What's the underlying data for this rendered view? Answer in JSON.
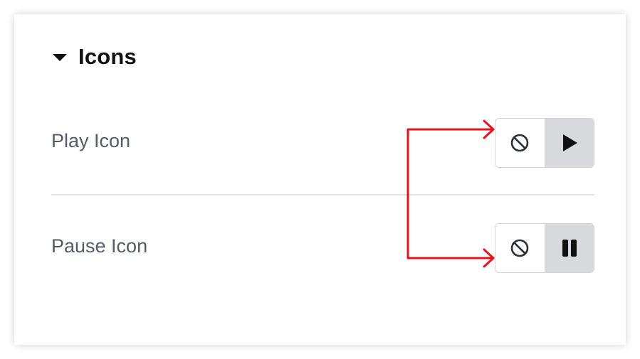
{
  "section": {
    "title": "Icons",
    "expanded": true
  },
  "rows": [
    {
      "label": "Play Icon",
      "options": [
        {
          "icon": "ban-icon",
          "selected": false
        },
        {
          "icon": "play-icon",
          "selected": true
        }
      ]
    },
    {
      "label": "Pause Icon",
      "options": [
        {
          "icon": "ban-icon",
          "selected": false
        },
        {
          "icon": "pause-icon",
          "selected": true
        }
      ]
    }
  ],
  "colors": {
    "annotation_arrow": "#e3141c",
    "selected_segment": "#d7d9dd",
    "label_text": "#555b66"
  }
}
